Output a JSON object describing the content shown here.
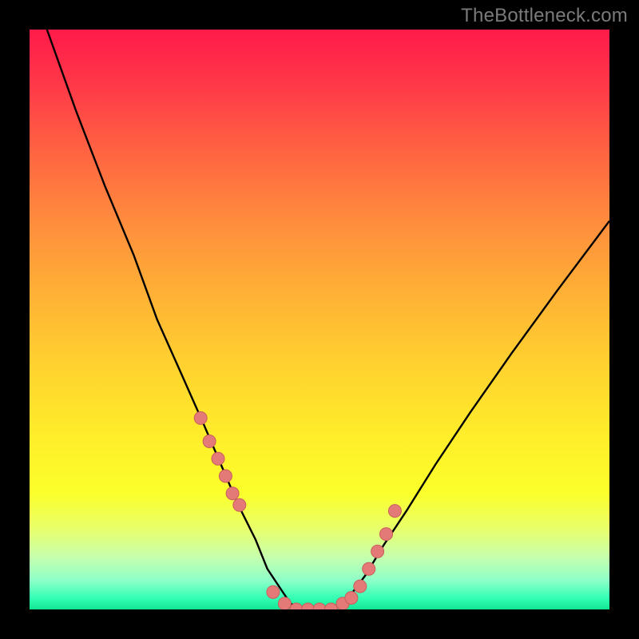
{
  "watermark": "TheBottleneck.com",
  "chart_data": {
    "type": "line",
    "title": "",
    "xlabel": "",
    "ylabel": "",
    "xlim": [
      0,
      100
    ],
    "ylim": [
      0,
      100
    ],
    "series": [
      {
        "name": "bottleneck-curve",
        "x": [
          3,
          8,
          13,
          18,
          22,
          26,
          30,
          33,
          36,
          39,
          41,
          43,
          45,
          47,
          49,
          52,
          55,
          58,
          61,
          65,
          70,
          76,
          83,
          91,
          100
        ],
        "y": [
          100,
          86,
          73,
          61,
          50,
          41,
          32,
          25,
          18,
          12,
          7,
          4,
          1,
          0,
          0,
          0,
          2,
          6,
          11,
          17,
          25,
          34,
          44,
          55,
          67
        ]
      }
    ],
    "markers": {
      "name": "data-dots",
      "x": [
        29.5,
        31,
        32.5,
        33.8,
        35,
        36.2,
        42,
        44,
        46,
        48,
        50,
        52,
        54,
        55.5,
        57,
        58.5,
        60,
        61.5,
        63
      ],
      "y": [
        33,
        29,
        26,
        23,
        20,
        18,
        3,
        1,
        0,
        0,
        0,
        0,
        1,
        2,
        4,
        7,
        10,
        13,
        17
      ]
    },
    "colors": {
      "curve": "#000000",
      "marker_fill": "#e47a78",
      "marker_stroke": "#c95d5b"
    }
  }
}
